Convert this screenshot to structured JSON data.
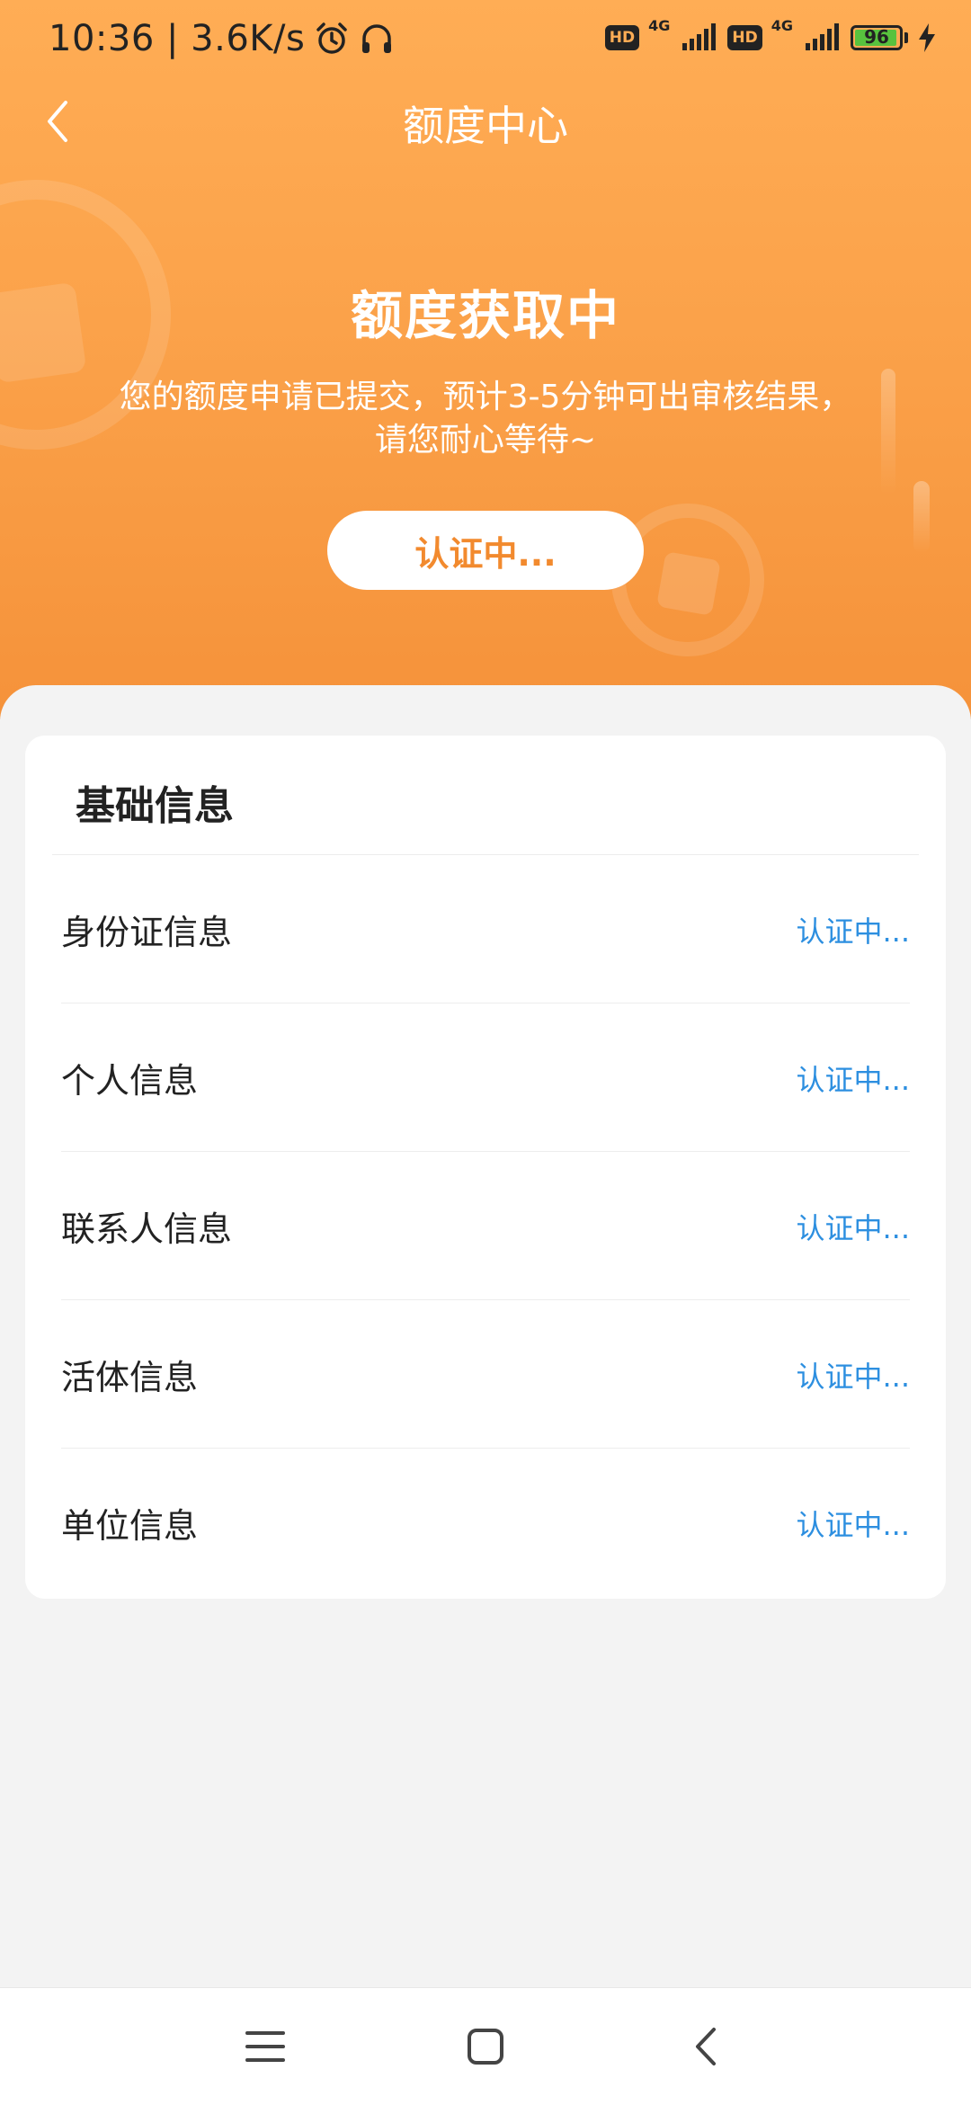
{
  "status_bar": {
    "time_speed": "10:36 | 3.6K/s",
    "hd1": "HD",
    "net1": "4G",
    "hd2": "HD",
    "net2": "4G",
    "battery": "96",
    "battery_level": 0.96
  },
  "header": {
    "title": "额度中心"
  },
  "hero": {
    "title": "额度获取中",
    "description": "您的额度申请已提交，预计3-5分钟可出审核结果，请您耐心等待~",
    "button_label": "认证中..."
  },
  "basic_info": {
    "title": "基础信息",
    "items": [
      {
        "label": "身份证信息",
        "status": "认证中..."
      },
      {
        "label": "个人信息",
        "status": "认证中..."
      },
      {
        "label": "联系人信息",
        "status": "认证中..."
      },
      {
        "label": "活体信息",
        "status": "认证中..."
      },
      {
        "label": "单位信息",
        "status": "认证中..."
      }
    ]
  },
  "colors": {
    "accent": "#fba24a",
    "status_text": "#2d8fe0",
    "button_text": "#f28a2e"
  }
}
